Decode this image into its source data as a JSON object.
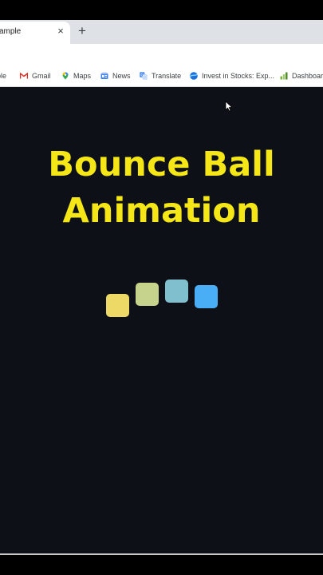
{
  "browser": {
    "tab": {
      "title": "xample",
      "close_glyph": "×"
    },
    "new_tab_glyph": "+",
    "bookmarks": [
      {
        "label": "ble",
        "icon": "bookmark-icon"
      },
      {
        "label": "Gmail",
        "icon": "gmail-icon"
      },
      {
        "label": "Maps",
        "icon": "maps-pin-icon"
      },
      {
        "label": "News",
        "icon": "news-icon"
      },
      {
        "label": "Translate",
        "icon": "translate-icon"
      },
      {
        "label": "Invest in Stocks: Exp...",
        "icon": "stocks-icon"
      },
      {
        "label": "Dashboar",
        "icon": "dashboard-bars-icon"
      }
    ]
  },
  "page": {
    "title_line1": "Bounce Ball",
    "title_line2": "Animation",
    "background_color": "#0d1117",
    "title_color": "#f5e617",
    "squares": [
      {
        "color": "#ecd966"
      },
      {
        "color": "#c5d38c"
      },
      {
        "color": "#7fbfce"
      },
      {
        "color": "#4aaef7"
      }
    ]
  }
}
